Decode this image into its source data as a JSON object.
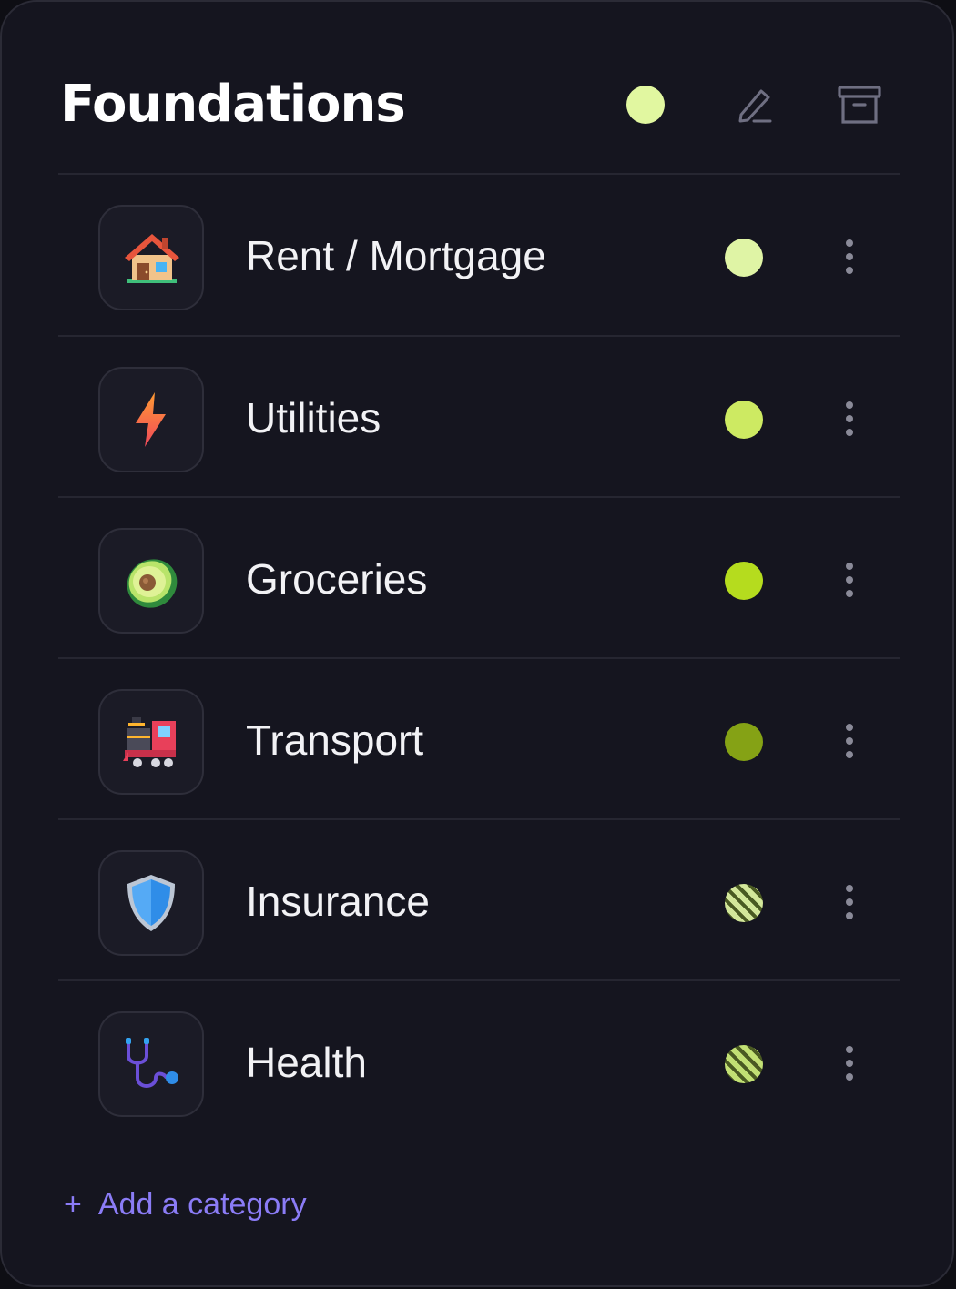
{
  "group": {
    "title": "Foundations",
    "color": "#e1f7a0",
    "edit_icon": "pencil-icon",
    "archive_icon": "archive-box-icon"
  },
  "categories": [
    {
      "label": "Rent / Mortgage",
      "icon": "house-icon",
      "color": "#dff4a5",
      "pattern": "solid"
    },
    {
      "label": "Utilities",
      "icon": "lightning-bolt-icon",
      "color": "#cdea62",
      "pattern": "solid"
    },
    {
      "label": "Groceries",
      "icon": "avocado-icon",
      "color": "#b5dc1e",
      "pattern": "solid"
    },
    {
      "label": "Transport",
      "icon": "train-icon",
      "color": "#85a215",
      "pattern": "solid"
    },
    {
      "label": "Insurance",
      "icon": "shield-icon",
      "color": "#d3e79a",
      "pattern": "striped"
    },
    {
      "label": "Health",
      "icon": "stethoscope-icon",
      "color": "#c2e074",
      "pattern": "striped"
    }
  ],
  "add_category": {
    "plus": "+",
    "label": "Add a category"
  }
}
